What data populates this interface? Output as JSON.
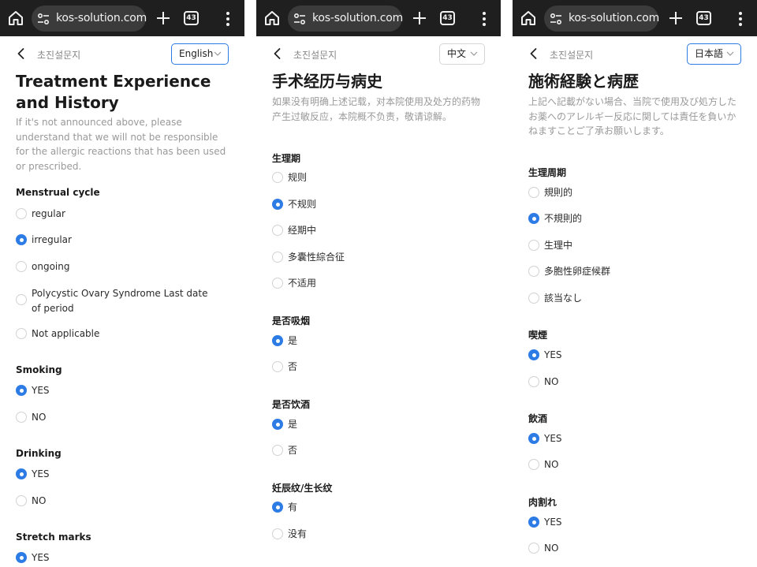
{
  "browser": {
    "url": "kos-solution.com",
    "tab_count": "43"
  },
  "panels": [
    {
      "breadcrumb": "초진설문지",
      "language": "English",
      "title": "Treatment Experience and History",
      "description": "If it's not announced above, please understand that we will not be responsible for the allergic reactions that has been used or prescribed.",
      "sections": [
        {
          "label": "Menstrual cycle",
          "options": [
            {
              "label": "regular",
              "checked": false
            },
            {
              "label": "irregular",
              "checked": true
            },
            {
              "label": "ongoing",
              "checked": false
            },
            {
              "label": "Polycystic Ovary Syndrome Last date of period",
              "checked": false
            },
            {
              "label": "Not applicable",
              "checked": false
            }
          ]
        },
        {
          "label": "Smoking",
          "options": [
            {
              "label": "YES",
              "checked": true
            },
            {
              "label": "NO",
              "checked": false
            }
          ]
        },
        {
          "label": "Drinking",
          "options": [
            {
              "label": "YES",
              "checked": true
            },
            {
              "label": "NO",
              "checked": false
            }
          ]
        },
        {
          "label": "Stretch marks",
          "options": [
            {
              "label": "YES",
              "checked": true
            }
          ]
        }
      ]
    },
    {
      "breadcrumb": "초진설문지",
      "language": "中文",
      "title": "手术经历与病史",
      "description": "如果没有明确上述记载，对本院使用及处方的药物产生过敏反应，本院概不负责，敬请谅解。",
      "sections": [
        {
          "label": "生理期",
          "options": [
            {
              "label": "规则",
              "checked": false
            },
            {
              "label": "不规则",
              "checked": true
            },
            {
              "label": "经期中",
              "checked": false
            },
            {
              "label": "多囊性綜合征",
              "checked": false
            },
            {
              "label": "不适用",
              "checked": false
            }
          ]
        },
        {
          "label": "是否吸烟",
          "options": [
            {
              "label": "是",
              "checked": true
            },
            {
              "label": "否",
              "checked": false
            }
          ]
        },
        {
          "label": "是否饮酒",
          "options": [
            {
              "label": "是",
              "checked": true
            },
            {
              "label": "否",
              "checked": false
            }
          ]
        },
        {
          "label": "妊辰纹/生长纹",
          "options": [
            {
              "label": "有",
              "checked": true
            },
            {
              "label": "没有",
              "checked": false
            }
          ]
        }
      ]
    },
    {
      "breadcrumb": "초진설문지",
      "language": "日本語",
      "title": "施術経験と病歴",
      "description": "上記へ記載がない場合、当院で使用及び処方したお薬へのアレルギー反応に関しては責任を負いかねますことご了承お願いします。",
      "sections": [
        {
          "label": "生理周期",
          "options": [
            {
              "label": "規則的",
              "checked": false
            },
            {
              "label": "不規則的",
              "checked": true
            },
            {
              "label": "生理中",
              "checked": false
            },
            {
              "label": "多胞性卵症候群",
              "checked": false
            },
            {
              "label": "該当なし",
              "checked": false
            }
          ]
        },
        {
          "label": "喫煙",
          "options": [
            {
              "label": "YES",
              "checked": true
            },
            {
              "label": "NO",
              "checked": false
            }
          ]
        },
        {
          "label": "飲酒",
          "options": [
            {
              "label": "YES",
              "checked": true
            },
            {
              "label": "NO",
              "checked": false
            }
          ]
        },
        {
          "label": "肉割れ",
          "options": [
            {
              "label": "YES",
              "checked": true
            },
            {
              "label": "NO",
              "checked": false
            }
          ]
        }
      ]
    }
  ],
  "colors": {
    "accent": "#2d7be5",
    "topbar": "#1f1f1f",
    "url_pill": "#3b3b3b"
  }
}
